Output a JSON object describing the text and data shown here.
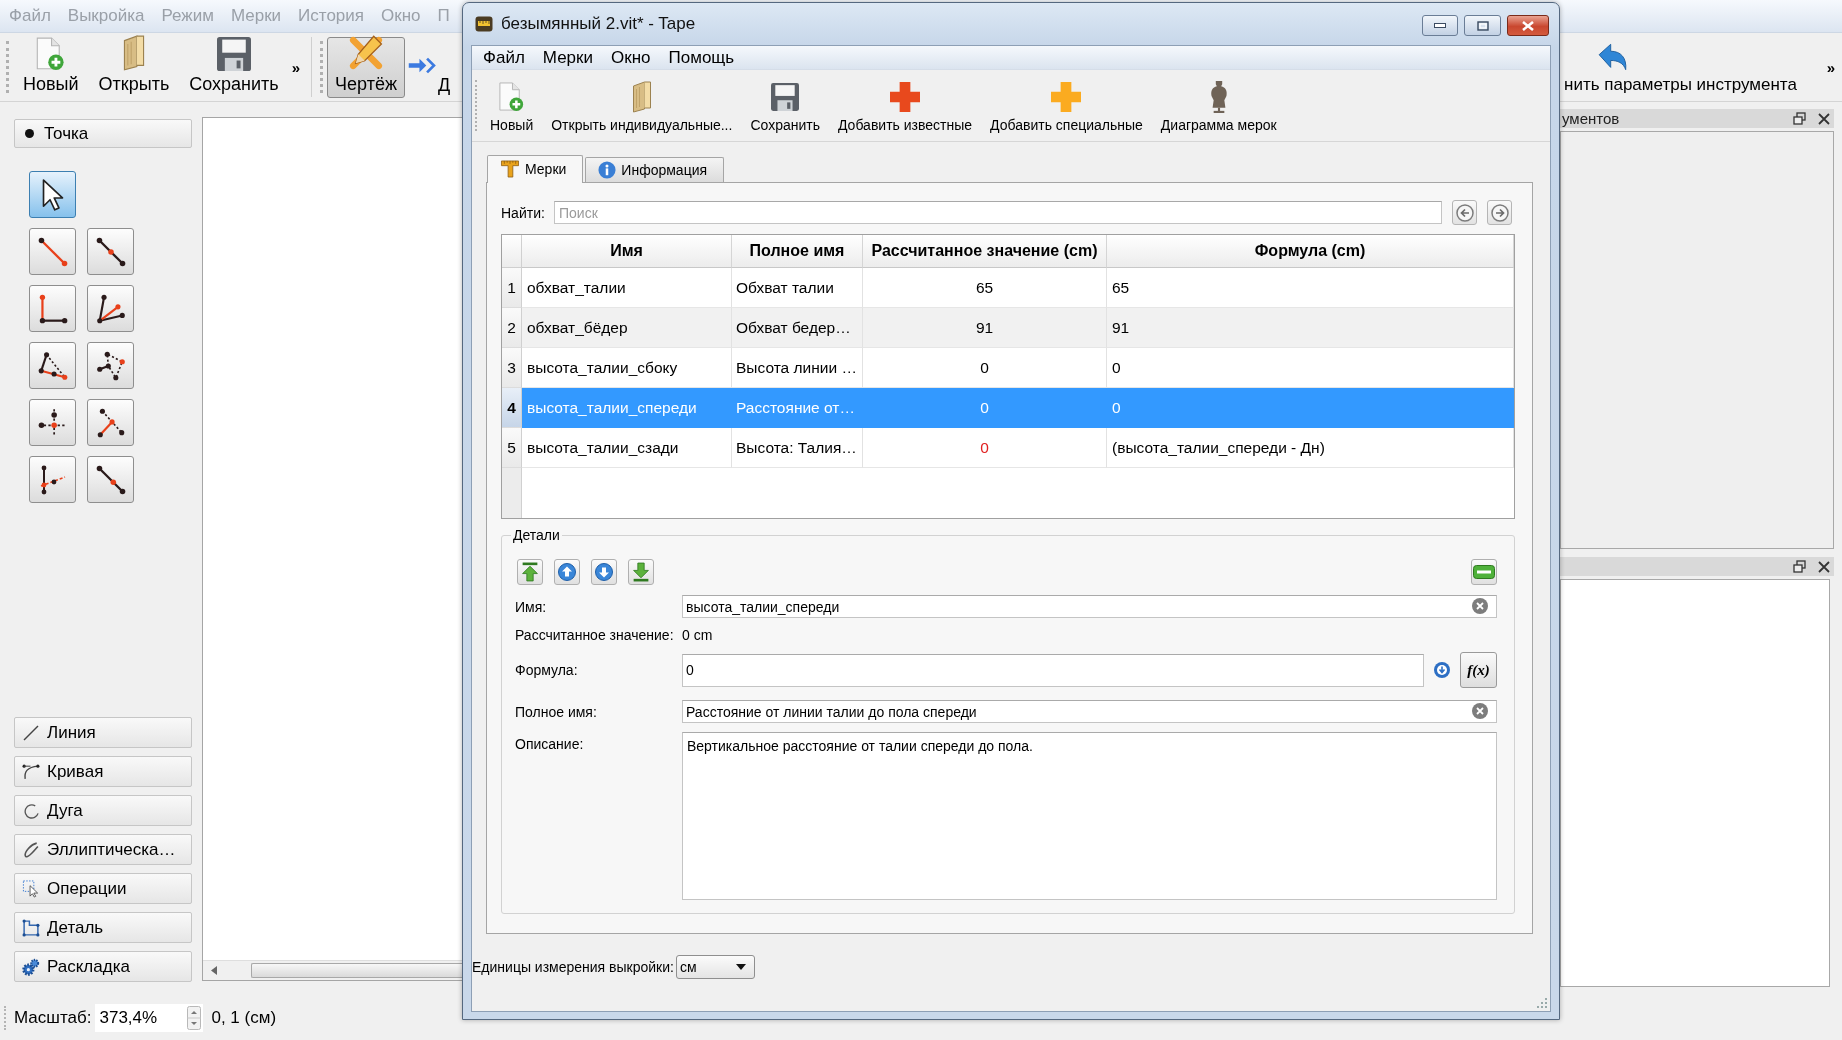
{
  "main_window": {
    "menu_bar": {
      "dimmed": true,
      "items": [
        "Файл",
        "Выкройка",
        "Режим",
        "Мерки",
        "История",
        "Окно",
        "П"
      ]
    },
    "file_toolbar": {
      "buttons": [
        {
          "label": "Новый"
        },
        {
          "label": "Открыть"
        },
        {
          "label": "Сохранить"
        }
      ],
      "overflow": "»"
    },
    "mode_toolbar": {
      "buttons": [
        {
          "label": "Чертёж",
          "checked": true
        },
        {
          "label": "Д",
          "checked": false
        }
      ]
    },
    "tool_toolbar": {
      "label": "нить параметры инструмента",
      "overflow": "»"
    },
    "tools_panel": {
      "header": "Точка",
      "tools": [
        {
          "selected": true
        },
        {
          "selected": false
        },
        {
          "selected": false
        },
        {
          "selected": false
        },
        {
          "selected": false
        },
        {
          "selected": false
        },
        {
          "selected": false
        },
        {
          "selected": false
        },
        {
          "selected": false
        },
        {
          "selected": false
        },
        {
          "selected": false
        }
      ],
      "groups": [
        "Линия",
        "Кривая",
        "Дуга",
        "Эллиптическа…",
        "Операции",
        "Деталь",
        "Раскладка"
      ]
    },
    "tool_options_dock": {
      "title": "ументов"
    },
    "status_bar": {
      "zoom_label": "Масштаб:",
      "zoom_value": "373,4%",
      "coordinates": "0, 1 (см)"
    }
  },
  "tape_window": {
    "title": "безымянный 2.vit* - Tape",
    "menu": [
      "Файл",
      "Мерки",
      "Окно",
      "Помощь"
    ],
    "toolbar": [
      {
        "label": "Новый"
      },
      {
        "label": "Открыть индивидуальные..."
      },
      {
        "label": "Сохранить"
      },
      {
        "label": "Добавить известные"
      },
      {
        "label": "Добавить специальные"
      },
      {
        "label": "Диаграмма мерок"
      }
    ],
    "tabs": [
      {
        "label": "Мерки",
        "selected": true
      },
      {
        "label": "Информация",
        "selected": false
      }
    ],
    "search": {
      "label": "Найти:",
      "placeholder": "Поиск"
    },
    "table": {
      "columns": [
        "Имя",
        "Полное имя",
        "Рассчитанное значение (cm)",
        "Формула (cm)"
      ],
      "rows": [
        {
          "number": "1",
          "name": "обхват_талии",
          "full_name": "Обхват талии",
          "value": "65",
          "formula": "65",
          "selected": false,
          "error": false
        },
        {
          "number": "2",
          "name": "обхват_бёдер",
          "full_name": "Обхват бедер…",
          "value": "91",
          "formula": "91",
          "selected": false,
          "error": false
        },
        {
          "number": "3",
          "name": "высота_талии_сбоку",
          "full_name": "Высота линии …",
          "value": "0",
          "formula": "0",
          "selected": false,
          "error": false
        },
        {
          "number": "4",
          "name": "высота_талии_спереди",
          "full_name": "Расстояние от…",
          "value": "0",
          "formula": "0",
          "selected": true,
          "error": false
        },
        {
          "number": "5",
          "name": "высота_талии_сзади",
          "full_name": "Высота: Талия…",
          "value": "0",
          "formula": "(высота_талии_спереди - Дн)",
          "selected": false,
          "error": true
        }
      ]
    },
    "details": {
      "title": "Детали",
      "name_label": "Имя:",
      "name": "высота_талии_спереди",
      "value_label": "Рассчитанное значение:",
      "value": "0 cm",
      "formula_label": "Формула:",
      "formula": "0",
      "function_button": "f(x)",
      "full_name_label": "Полное имя:",
      "full_name": "Расстояние от линии талии до пола спереди",
      "description_label": "Описание:",
      "description": "Вертикальное расстояние от талии спереди до пола."
    },
    "units": {
      "label": "Единицы измерения выкройки:",
      "value": "см"
    }
  }
}
